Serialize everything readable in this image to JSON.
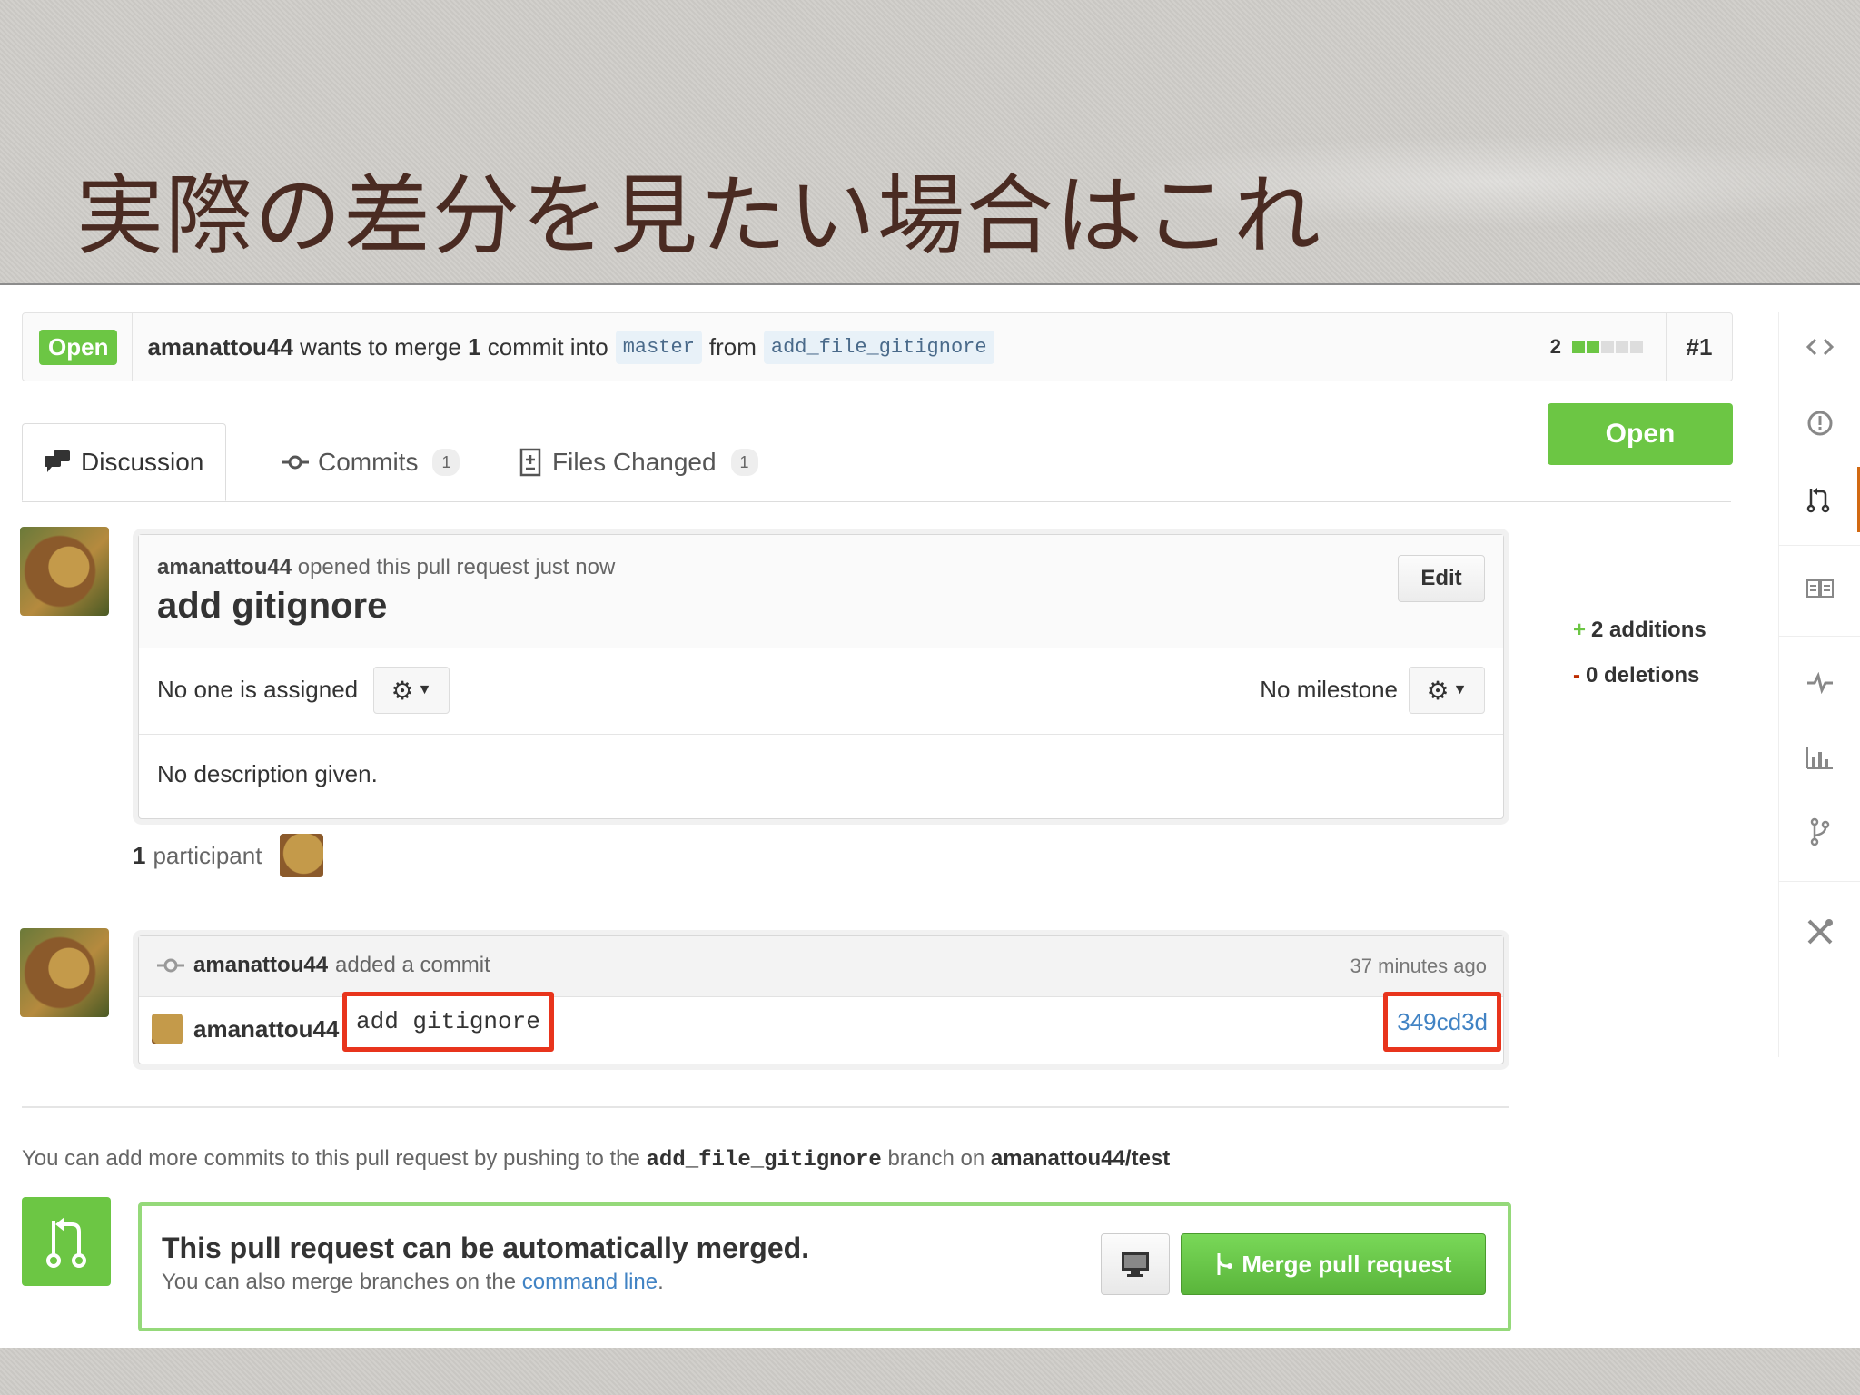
{
  "slide": {
    "title": "実際の差分を見たい場合はこれ"
  },
  "pr": {
    "state": "Open",
    "author": "amanattou44",
    "merge_text_a": "wants to merge",
    "commit_count": "1",
    "merge_text_b": "commit into",
    "base_branch": "master",
    "from_text": "from",
    "head_branch": "add_file_gitignore",
    "diffstat_count": "2",
    "diffstat": {
      "additions_blocks": 2,
      "total_blocks": 5,
      "add_color": "#6cc644"
    },
    "number": "#1"
  },
  "tabs": [
    {
      "label": "Discussion",
      "icon": "comment-discussion-icon"
    },
    {
      "label": "Commits",
      "icon": "git-commit-icon",
      "count": "1"
    },
    {
      "label": "Files Changed",
      "icon": "diff-icon",
      "count": "1"
    }
  ],
  "discussion": {
    "author": "amanattou44",
    "opened_text": "opened this pull request just now",
    "title": "add gitignore",
    "edit_label": "Edit",
    "assignee_text": "No one is assigned",
    "milestone_text": "No milestone",
    "description": "No description given."
  },
  "participants": {
    "count": "1",
    "label": "participant"
  },
  "commit_event": {
    "author": "amanattou44",
    "action": "added a commit",
    "time": "37 minutes ago",
    "commit_author": "amanattou44",
    "message": "add gitignore",
    "sha": "349cd3d"
  },
  "push_note": {
    "prefix": "You can add more commits to this pull request by pushing to the",
    "branch": "add_file_gitignore",
    "middle": "branch on",
    "repo": "amanattou44/test"
  },
  "merge": {
    "title": "This pull request can be automatically merged.",
    "sub_prefix": "You can also merge branches on the",
    "link": "command line",
    "sub_suffix": ".",
    "button": "Merge pull request"
  },
  "sidebar": {
    "state": "Open",
    "additions": "2 additions",
    "deletions": "0 deletions"
  },
  "repo_nav": [
    {
      "icon": "code-icon"
    },
    {
      "icon": "issue-opened-icon"
    },
    {
      "icon": "pull-request-icon",
      "active": true
    },
    {
      "icon": "book-icon"
    },
    {
      "icon": "pulse-icon"
    },
    {
      "icon": "graph-icon"
    },
    {
      "icon": "network-icon"
    },
    {
      "icon": "tools-icon"
    }
  ],
  "colors": {
    "accent_green": "#6cc644",
    "highlight_red": "#e8341c",
    "link_blue": "#4183c4",
    "title_brown": "#4a2b22"
  }
}
